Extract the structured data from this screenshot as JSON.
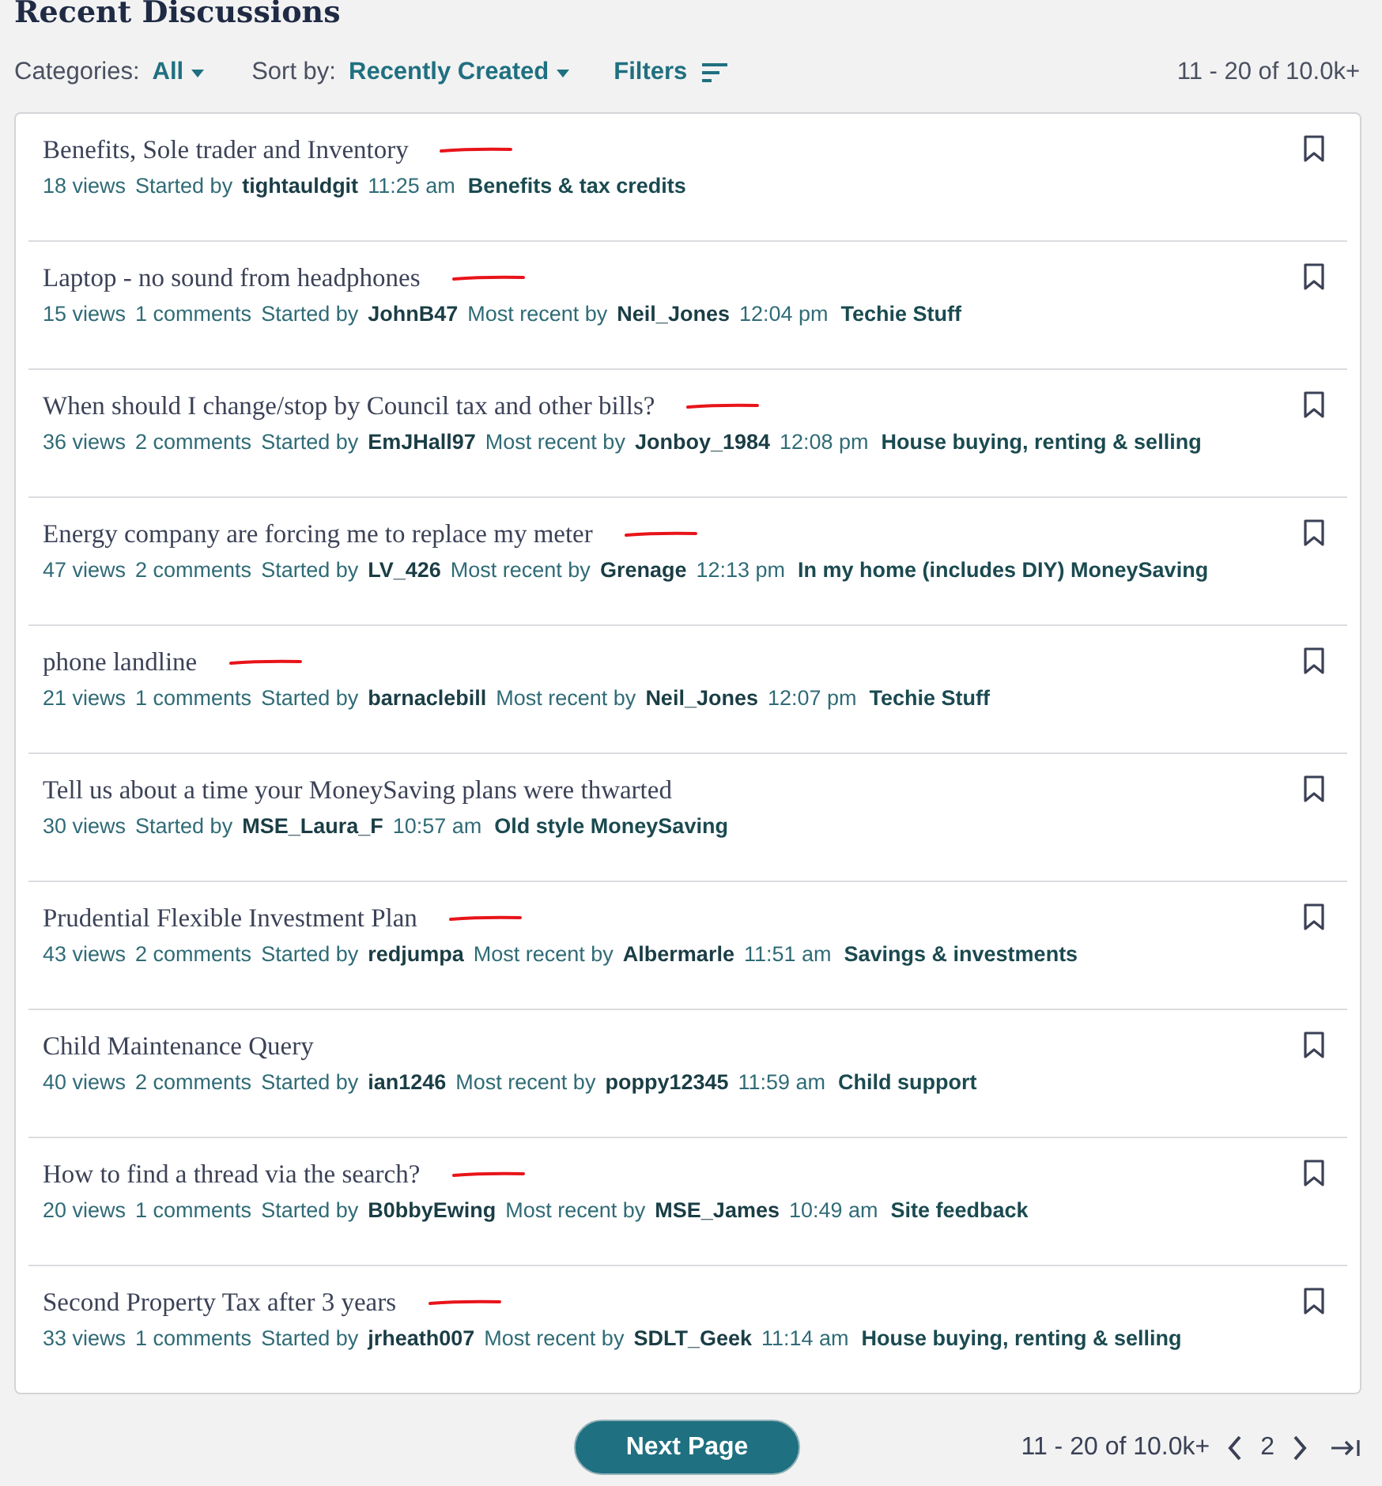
{
  "heading": "Recent Discussions",
  "toolbar": {
    "categories_label": "Categories:",
    "categories_value": "All",
    "sort_label": "Sort by:",
    "sort_value": "Recently Created",
    "filters": "Filters",
    "range": "11 - 20 of 10.0k+"
  },
  "discussions": [
    {
      "title": "Benefits, Sole trader and Inventory",
      "marked": true,
      "meta": [
        {
          "kind": "plain",
          "text": "18 views"
        },
        {
          "kind": "plain",
          "text": "Started by"
        },
        {
          "kind": "user",
          "text": "tightauldgit"
        },
        {
          "kind": "plain",
          "text": "11:25 am"
        },
        {
          "kind": "category",
          "text": "Benefits & tax credits"
        }
      ]
    },
    {
      "title": "Laptop - no sound from headphones",
      "marked": true,
      "meta": [
        {
          "kind": "plain",
          "text": "15 views"
        },
        {
          "kind": "plain",
          "text": "1 comments"
        },
        {
          "kind": "plain",
          "text": "Started by"
        },
        {
          "kind": "user",
          "text": "JohnB47"
        },
        {
          "kind": "plain",
          "text": "Most recent by"
        },
        {
          "kind": "user",
          "text": "Neil_Jones"
        },
        {
          "kind": "plain",
          "text": "12:04 pm"
        },
        {
          "kind": "category",
          "text": "Techie Stuff"
        }
      ]
    },
    {
      "title": "When should I change/stop by Council tax and other bills?",
      "marked": true,
      "meta": [
        {
          "kind": "plain",
          "text": "36 views"
        },
        {
          "kind": "plain",
          "text": "2 comments"
        },
        {
          "kind": "plain",
          "text": "Started by"
        },
        {
          "kind": "user",
          "text": "EmJHall97"
        },
        {
          "kind": "plain",
          "text": "Most recent by"
        },
        {
          "kind": "user",
          "text": "Jonboy_1984"
        },
        {
          "kind": "plain",
          "text": "12:08 pm"
        },
        {
          "kind": "category",
          "text": "House buying, renting & selling"
        }
      ]
    },
    {
      "title": "Energy company are forcing me to replace my meter",
      "marked": true,
      "meta": [
        {
          "kind": "plain",
          "text": "47 views"
        },
        {
          "kind": "plain",
          "text": "2 comments"
        },
        {
          "kind": "plain",
          "text": "Started by"
        },
        {
          "kind": "user",
          "text": "LV_426"
        },
        {
          "kind": "plain",
          "text": "Most recent by"
        },
        {
          "kind": "user",
          "text": "Grenage"
        },
        {
          "kind": "plain",
          "text": "12:13 pm"
        },
        {
          "kind": "category",
          "text": "In my home (includes DIY) MoneySaving"
        }
      ]
    },
    {
      "title": "phone landline",
      "marked": true,
      "meta": [
        {
          "kind": "plain",
          "text": "21 views"
        },
        {
          "kind": "plain",
          "text": "1 comments"
        },
        {
          "kind": "plain",
          "text": "Started by"
        },
        {
          "kind": "user",
          "text": "barnaclebill"
        },
        {
          "kind": "plain",
          "text": "Most recent by"
        },
        {
          "kind": "user",
          "text": "Neil_Jones"
        },
        {
          "kind": "plain",
          "text": "12:07 pm"
        },
        {
          "kind": "category",
          "text": "Techie Stuff"
        }
      ]
    },
    {
      "title": "Tell us about a time your MoneySaving plans were thwarted",
      "marked": false,
      "meta": [
        {
          "kind": "plain",
          "text": "30 views"
        },
        {
          "kind": "plain",
          "text": "Started by"
        },
        {
          "kind": "user",
          "text": "MSE_Laura_F"
        },
        {
          "kind": "plain",
          "text": "10:57 am"
        },
        {
          "kind": "category",
          "text": "Old style MoneySaving"
        }
      ]
    },
    {
      "title": "Prudential Flexible Investment Plan",
      "marked": true,
      "meta": [
        {
          "kind": "plain",
          "text": "43 views"
        },
        {
          "kind": "plain",
          "text": "2 comments"
        },
        {
          "kind": "plain",
          "text": "Started by"
        },
        {
          "kind": "user",
          "text": "redjumpa"
        },
        {
          "kind": "plain",
          "text": "Most recent by"
        },
        {
          "kind": "user",
          "text": "Albermarle"
        },
        {
          "kind": "plain",
          "text": "11:51 am"
        },
        {
          "kind": "category",
          "text": "Savings & investments"
        }
      ]
    },
    {
      "title": "Child Maintenance Query",
      "marked": false,
      "meta": [
        {
          "kind": "plain",
          "text": "40 views"
        },
        {
          "kind": "plain",
          "text": "2 comments"
        },
        {
          "kind": "plain",
          "text": "Started by"
        },
        {
          "kind": "user",
          "text": "ian1246"
        },
        {
          "kind": "plain",
          "text": "Most recent by"
        },
        {
          "kind": "user",
          "text": "poppy12345"
        },
        {
          "kind": "plain",
          "text": "11:59 am"
        },
        {
          "kind": "category",
          "text": "Child support"
        }
      ]
    },
    {
      "title": "How to find a thread via the search?",
      "marked": true,
      "meta": [
        {
          "kind": "plain",
          "text": "20 views"
        },
        {
          "kind": "plain",
          "text": "1 comments"
        },
        {
          "kind": "plain",
          "text": "Started by"
        },
        {
          "kind": "user",
          "text": "B0bbyEwing"
        },
        {
          "kind": "plain",
          "text": "Most recent by"
        },
        {
          "kind": "user",
          "text": "MSE_James"
        },
        {
          "kind": "plain",
          "text": "10:49 am"
        },
        {
          "kind": "category",
          "text": "Site feedback"
        }
      ]
    },
    {
      "title": "Second Property Tax after 3 years",
      "marked": true,
      "meta": [
        {
          "kind": "plain",
          "text": "33 views"
        },
        {
          "kind": "plain",
          "text": "1 comments"
        },
        {
          "kind": "plain",
          "text": "Started by"
        },
        {
          "kind": "user",
          "text": "jrheath007"
        },
        {
          "kind": "plain",
          "text": "Most recent by"
        },
        {
          "kind": "user",
          "text": "SDLT_Geek"
        },
        {
          "kind": "plain",
          "text": "11:14 am"
        },
        {
          "kind": "category",
          "text": "House buying, renting & selling"
        }
      ]
    }
  ],
  "footer": {
    "next_button": "Next Page",
    "range": "11 - 20 of 10.0k+",
    "page": "2"
  }
}
